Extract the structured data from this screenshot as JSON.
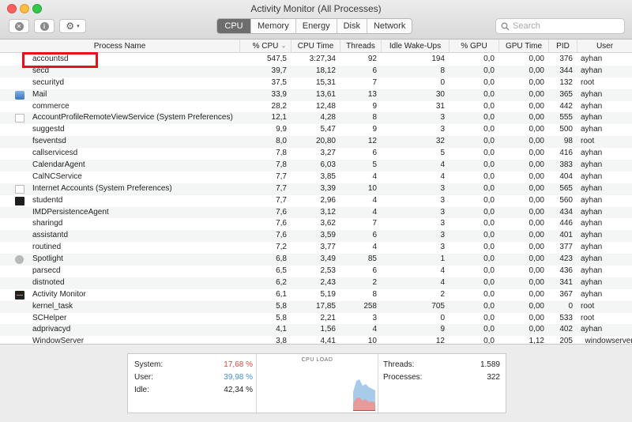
{
  "window": {
    "title": "Activity Monitor (All Processes)"
  },
  "toolbar": {
    "stop_icon_glyph": "✕",
    "info_icon_glyph": "i",
    "gear_icon_glyph": "⚙",
    "chevron_glyph": "▾",
    "search_placeholder": "Search",
    "tabs": [
      {
        "label": "CPU",
        "active": true
      },
      {
        "label": "Memory",
        "active": false
      },
      {
        "label": "Energy",
        "active": false
      },
      {
        "label": "Disk",
        "active": false
      },
      {
        "label": "Network",
        "active": false
      }
    ]
  },
  "table": {
    "columns": [
      "Process Name",
      "% CPU",
      "CPU Time",
      "Threads",
      "Idle Wake-Ups",
      "% GPU",
      "GPU Time",
      "PID",
      "User"
    ],
    "sort_arrow": "⌄",
    "rows": [
      {
        "icon": "",
        "name": "accountsd",
        "cpu": "547,5",
        "time": "3:27,34",
        "threads": "92",
        "idle": "194",
        "gpu": "0,0",
        "gputime": "0,00",
        "pid": "376",
        "user": "ayhan"
      },
      {
        "icon": "",
        "name": "secd",
        "cpu": "39,7",
        "time": "18,12",
        "threads": "6",
        "idle": "8",
        "gpu": "0,0",
        "gputime": "0,00",
        "pid": "344",
        "user": "ayhan"
      },
      {
        "icon": "",
        "name": "securityd",
        "cpu": "37,5",
        "time": "15,31",
        "threads": "7",
        "idle": "0",
        "gpu": "0,0",
        "gputime": "0,00",
        "pid": "132",
        "user": "root"
      },
      {
        "icon": "mail",
        "name": "Mail",
        "cpu": "33,9",
        "time": "13,61",
        "threads": "13",
        "idle": "30",
        "gpu": "0,0",
        "gputime": "0,00",
        "pid": "365",
        "user": "ayhan"
      },
      {
        "icon": "",
        "name": "commerce",
        "cpu": "28,2",
        "time": "12,48",
        "threads": "9",
        "idle": "31",
        "gpu": "0,0",
        "gputime": "0,00",
        "pid": "442",
        "user": "ayhan"
      },
      {
        "icon": "doc",
        "name": "AccountProfileRemoteViewService (System Preferences)",
        "cpu": "12,1",
        "time": "4,28",
        "threads": "8",
        "idle": "3",
        "gpu": "0,0",
        "gputime": "0,00",
        "pid": "555",
        "user": "ayhan"
      },
      {
        "icon": "",
        "name": "suggestd",
        "cpu": "9,9",
        "time": "5,47",
        "threads": "9",
        "idle": "3",
        "gpu": "0,0",
        "gputime": "0,00",
        "pid": "500",
        "user": "ayhan"
      },
      {
        "icon": "",
        "name": "fseventsd",
        "cpu": "8,0",
        "time": "20,80",
        "threads": "12",
        "idle": "32",
        "gpu": "0,0",
        "gputime": "0,00",
        "pid": "98",
        "user": "root"
      },
      {
        "icon": "",
        "name": "callservicesd",
        "cpu": "7,8",
        "time": "3,27",
        "threads": "6",
        "idle": "5",
        "gpu": "0,0",
        "gputime": "0,00",
        "pid": "416",
        "user": "ayhan"
      },
      {
        "icon": "",
        "name": "CalendarAgent",
        "cpu": "7,8",
        "time": "6,03",
        "threads": "5",
        "idle": "4",
        "gpu": "0,0",
        "gputime": "0,00",
        "pid": "383",
        "user": "ayhan"
      },
      {
        "icon": "",
        "name": "CalNCService",
        "cpu": "7,7",
        "time": "3,85",
        "threads": "4",
        "idle": "4",
        "gpu": "0,0",
        "gputime": "0,00",
        "pid": "404",
        "user": "ayhan"
      },
      {
        "icon": "doc",
        "name": "Internet Accounts (System Preferences)",
        "cpu": "7,7",
        "time": "3,39",
        "threads": "10",
        "idle": "3",
        "gpu": "0,0",
        "gputime": "0,00",
        "pid": "565",
        "user": "ayhan"
      },
      {
        "icon": "terminal",
        "name": "studentd",
        "cpu": "7,7",
        "time": "2,96",
        "threads": "4",
        "idle": "3",
        "gpu": "0,0",
        "gputime": "0,00",
        "pid": "560",
        "user": "ayhan"
      },
      {
        "icon": "",
        "name": "IMDPersistenceAgent",
        "cpu": "7,6",
        "time": "3,12",
        "threads": "4",
        "idle": "3",
        "gpu": "0,0",
        "gputime": "0,00",
        "pid": "434",
        "user": "ayhan"
      },
      {
        "icon": "",
        "name": "sharingd",
        "cpu": "7,6",
        "time": "3,62",
        "threads": "7",
        "idle": "3",
        "gpu": "0,0",
        "gputime": "0,00",
        "pid": "446",
        "user": "ayhan"
      },
      {
        "icon": "",
        "name": "assistantd",
        "cpu": "7,6",
        "time": "3,59",
        "threads": "6",
        "idle": "3",
        "gpu": "0,0",
        "gputime": "0,00",
        "pid": "401",
        "user": "ayhan"
      },
      {
        "icon": "",
        "name": "routined",
        "cpu": "7,2",
        "time": "3,77",
        "threads": "4",
        "idle": "3",
        "gpu": "0,0",
        "gputime": "0,00",
        "pid": "377",
        "user": "ayhan"
      },
      {
        "icon": "spotlight",
        "name": "Spotlight",
        "cpu": "6,8",
        "time": "3,49",
        "threads": "85",
        "idle": "1",
        "gpu": "0,0",
        "gputime": "0,00",
        "pid": "423",
        "user": "ayhan"
      },
      {
        "icon": "",
        "name": "parsecd",
        "cpu": "6,5",
        "time": "2,53",
        "threads": "6",
        "idle": "4",
        "gpu": "0,0",
        "gputime": "0,00",
        "pid": "436",
        "user": "ayhan"
      },
      {
        "icon": "",
        "name": "distnoted",
        "cpu": "6,2",
        "time": "2,43",
        "threads": "2",
        "idle": "4",
        "gpu": "0,0",
        "gputime": "0,00",
        "pid": "341",
        "user": "ayhan"
      },
      {
        "icon": "activity",
        "name": "Activity Monitor",
        "cpu": "6,1",
        "time": "5,19",
        "threads": "8",
        "idle": "2",
        "gpu": "0,0",
        "gputime": "0,00",
        "pid": "367",
        "user": "ayhan"
      },
      {
        "icon": "",
        "name": "kernel_task",
        "cpu": "5,8",
        "time": "17,85",
        "threads": "258",
        "idle": "705",
        "gpu": "0,0",
        "gputime": "0,00",
        "pid": "0",
        "user": "root"
      },
      {
        "icon": "",
        "name": "SCHelper",
        "cpu": "5,8",
        "time": "2,21",
        "threads": "3",
        "idle": "0",
        "gpu": "0,0",
        "gputime": "0,00",
        "pid": "533",
        "user": "root"
      },
      {
        "icon": "",
        "name": "adprivacyd",
        "cpu": "4,1",
        "time": "1,56",
        "threads": "4",
        "idle": "9",
        "gpu": "0,0",
        "gputime": "0,00",
        "pid": "402",
        "user": "ayhan"
      },
      {
        "icon": "",
        "name": "WindowServer",
        "cpu": "3,8",
        "time": "4,41",
        "threads": "10",
        "idle": "12",
        "gpu": "0,0",
        "gputime": "1,12",
        "pid": "205",
        "user": "_windowserver"
      }
    ]
  },
  "stats": {
    "system_label": "System:",
    "system_value": "17,68 %",
    "user_label": "User:",
    "user_value": "39,98 %",
    "idle_label": "Idle:",
    "idle_value": "42,34 %",
    "cpu_load_title": "CPU LOAD",
    "threads_label": "Threads:",
    "threads_value": "1.589",
    "processes_label": "Processes:",
    "processes_value": "322",
    "system_color": "#e0443a",
    "user_color": "#3f8fd6"
  }
}
